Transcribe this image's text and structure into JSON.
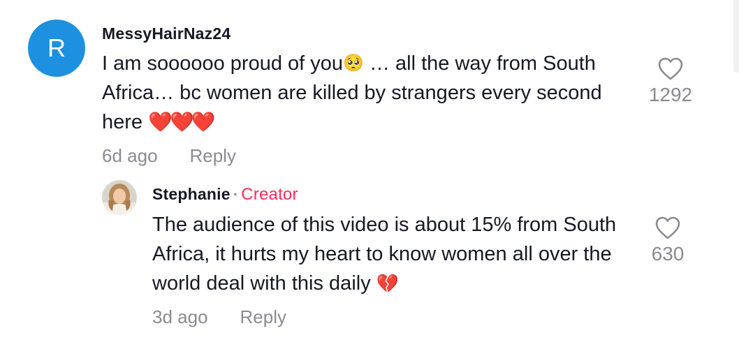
{
  "comments": [
    {
      "avatar_letter": "R",
      "username": "MessyHairNaz24",
      "text_part1": "I am soooooo proud of you",
      "emoji1": "🥺",
      "text_part2": " … all the way from South Africa… bc women are killed by strangers every second here ",
      "emoji2": "❤️❤️❤️",
      "time": "6d ago",
      "reply_label": "Reply",
      "likes": "1292",
      "avatar_color": "#1d91e0"
    },
    {
      "avatar_icon": "user-photo",
      "username": "Stephanie",
      "separator": "·",
      "creator_badge": "Creator",
      "text_part1": "The audience of this video is about 15% from South Africa, it hurts my heart to know women all over the world deal with this daily ",
      "emoji1": "💔",
      "time": "3d ago",
      "reply_label": "Reply",
      "likes": "630",
      "creator_color": "#fe2c55"
    }
  ]
}
